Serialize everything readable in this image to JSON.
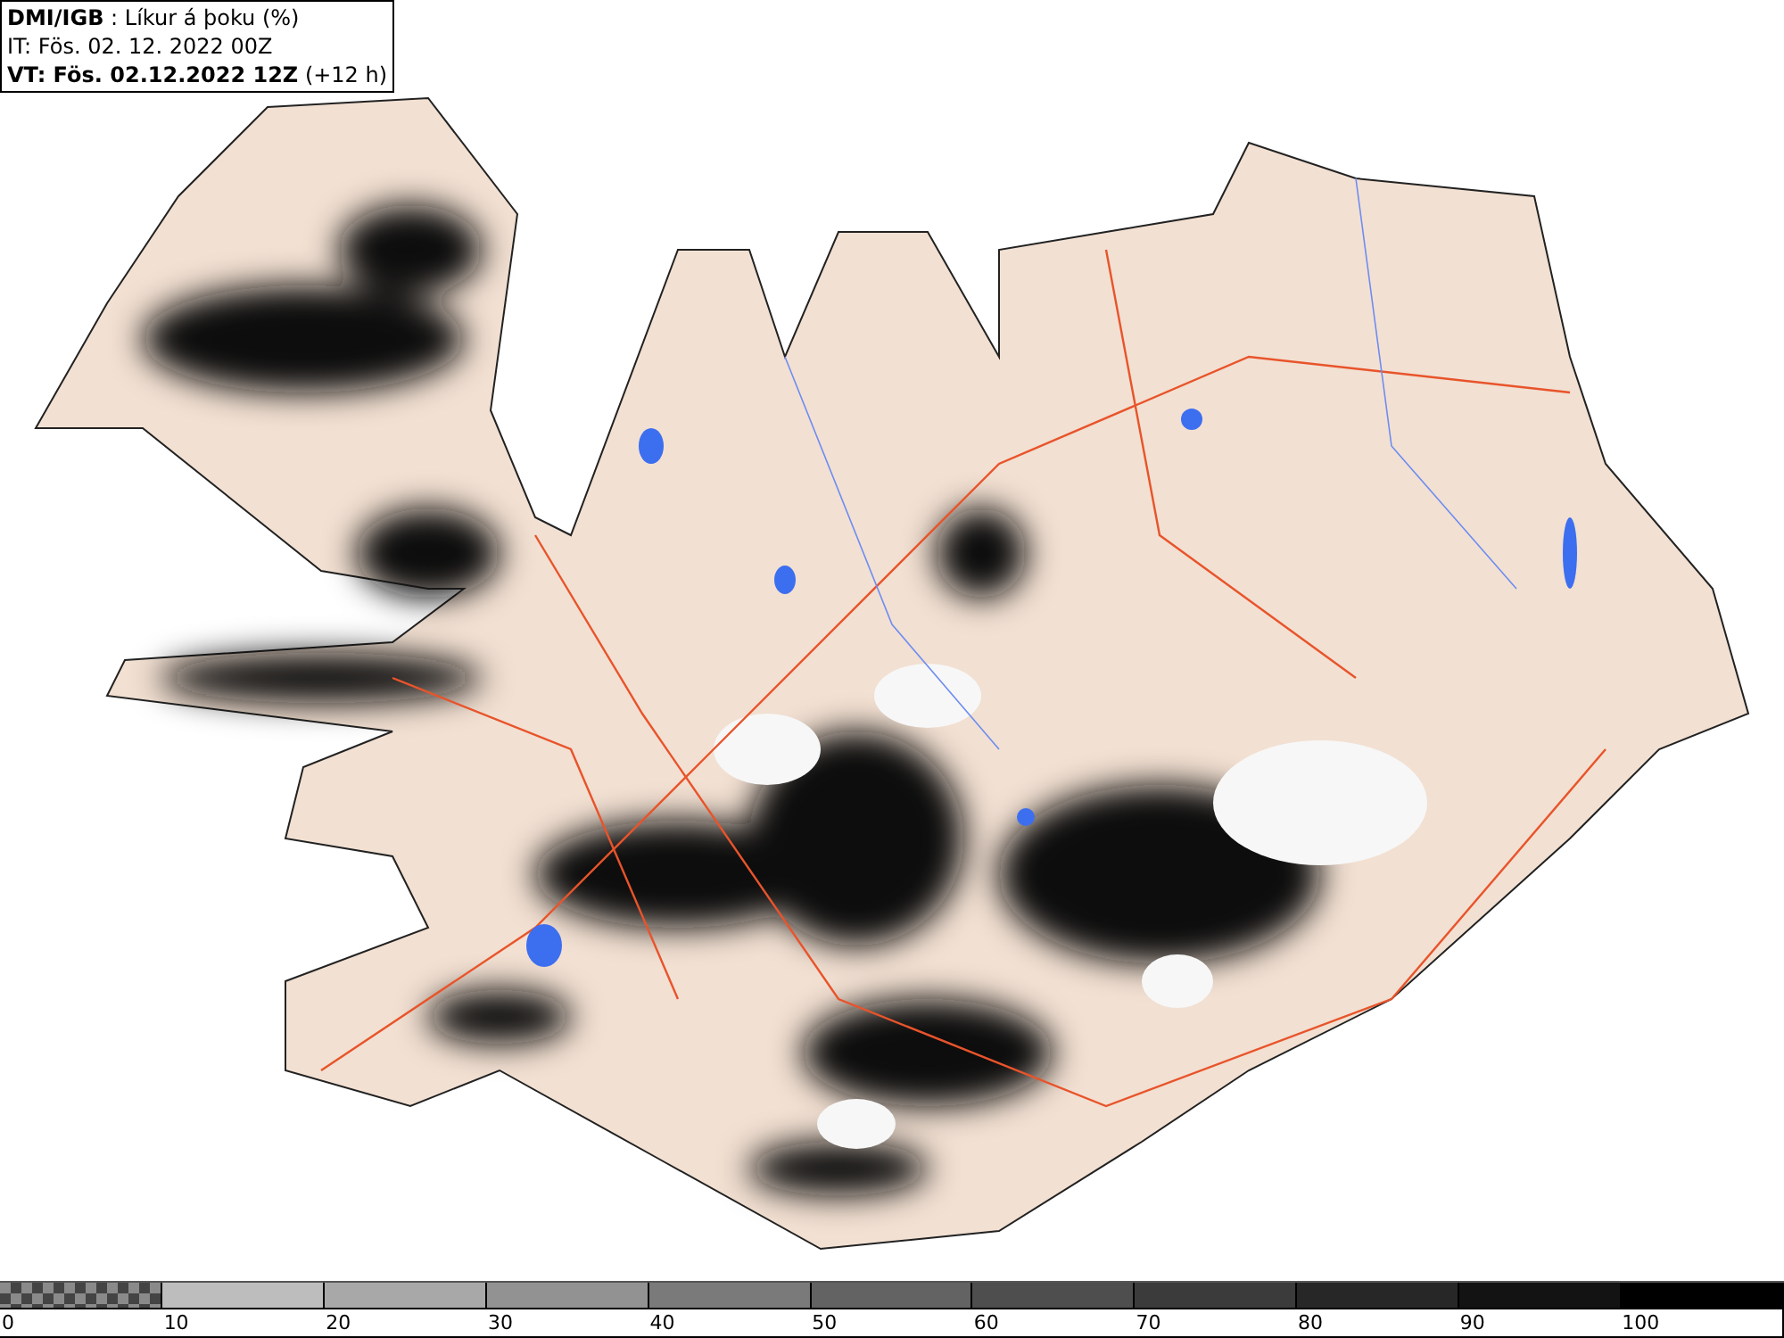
{
  "header": {
    "lines": [
      "**DMI/IGB** : Líkur á þoku (%)",
      "IT: Fös. 02. 12. 2022 00Z",
      "**VT: Fös. 02.12.2022 12Z** (+12 h)"
    ]
  },
  "legend": {
    "segments": [
      {
        "kind": "checkered",
        "color": "#8a8a8a"
      },
      {
        "kind": "solid",
        "color": "#bdbdbd"
      },
      {
        "kind": "solid",
        "color": "#a8a8a8"
      },
      {
        "kind": "solid",
        "color": "#929292"
      },
      {
        "kind": "solid",
        "color": "#7a7a7a"
      },
      {
        "kind": "solid",
        "color": "#636363"
      },
      {
        "kind": "solid",
        "color": "#4e4e4e"
      },
      {
        "kind": "solid",
        "color": "#3b3b3b"
      },
      {
        "kind": "solid",
        "color": "#272727"
      },
      {
        "kind": "solid",
        "color": "#131313"
      },
      {
        "kind": "solid",
        "color": "#000000"
      }
    ],
    "labels": [
      "0",
      "10",
      "20",
      "30",
      "40",
      "50",
      "60",
      "70",
      "80",
      "90",
      "100"
    ]
  }
}
